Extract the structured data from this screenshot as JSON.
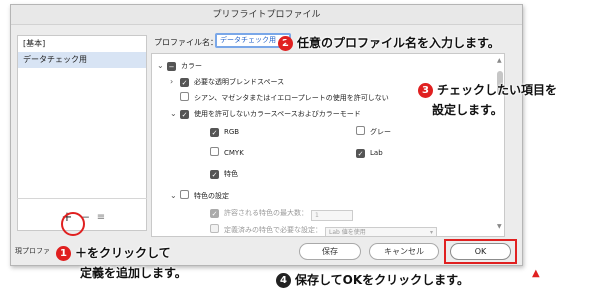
{
  "dialog": {
    "title": "プリフライトプロファイル",
    "profile_list": [
      "[基本]",
      "データチェック用"
    ],
    "selected_index": 1,
    "add_icon": "+",
    "remove_icon": "−",
    "menu_icon": "≡",
    "footer_text": "現プロファ",
    "profile_name_label": "プロファイル名：",
    "profile_name_value": "データチェック用",
    "save_label": "保存",
    "cancel_label": "キャンセル",
    "ok_label": "OK"
  },
  "settings": {
    "color_section": "カラー",
    "items": {
      "transparent_blend": "必要な透明ブレンドスペース",
      "cmy_allow": "シアン、マゼンタまたはイエロープレートの使用を許可しない",
      "disallowed_modes": "使用を許可しないカラースペースおよびカラーモード",
      "rgb": "RGB",
      "gray": "グレー",
      "cmyk": "CMYK",
      "lab": "Lab",
      "spot": "特色",
      "spot_settings": "特色の設定",
      "max_spot": "許容される特色の最大数：",
      "max_spot_value": "1",
      "lab_values": "定義済みの特色で必要な設定：",
      "lab_values_select": "Lab 値を使用"
    }
  },
  "annotations": {
    "a1_num": "1",
    "a1_line1": "＋をクリックして",
    "a1_line2": "定義を追加します。",
    "a2_num": "2",
    "a2_text": "任意のプロファイル名を入力します。",
    "a3_num": "3",
    "a3_line1": "チェックしたい項目を",
    "a3_line2": "設定します。",
    "a4_num": "4",
    "a4_text": "保存してOKをクリックします。"
  },
  "colors": {
    "accent": "#e02020",
    "selection": "#d8e4f4",
    "input_border": "#7aa7e8"
  }
}
